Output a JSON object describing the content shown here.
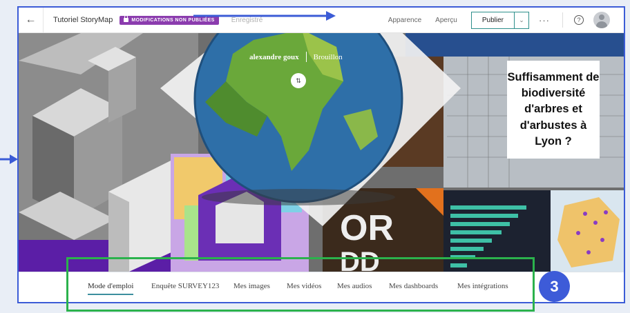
{
  "topbar": {
    "back_glyph": "←",
    "title": "Tutoriel StoryMap",
    "status_badge": "MODIFICATIONS NON PUBLIÉES",
    "saved_status": "Enregistré",
    "appearance": "Apparence",
    "preview": "Aperçu",
    "publish": "Publier",
    "publish_chevron": "⌄",
    "more": "···",
    "help": "?",
    "icons": [
      "back-arrow-icon",
      "lock-icon",
      "chevron-down-icon",
      "more-icon",
      "help-icon",
      "user-avatar-icon"
    ]
  },
  "cover": {
    "author": "alexandre goux",
    "status": "Brouillon",
    "swap_glyph": "⇅",
    "poster_lines": [
      "Suffisamment de",
      "biodiversité",
      "d'arbres et",
      "d'arbustes à",
      "Lyon ?"
    ]
  },
  "navigation": {
    "items": [
      {
        "label": "Mode d'emploi",
        "active": true
      },
      {
        "label": "Enquête SURVEY123",
        "active": false
      },
      {
        "label": "Mes images",
        "active": false
      },
      {
        "label": "Mes vidéos",
        "active": false
      },
      {
        "label": "Mes audios",
        "active": false
      },
      {
        "label": "Mes dashboards",
        "active": false
      },
      {
        "label": "Mes intégrations",
        "active": false
      }
    ]
  },
  "annotation": {
    "marker_number": "3",
    "colors": {
      "frame": "#3b5bd6",
      "highlight": "#2bb24c",
      "marker": "#3d5bd8",
      "badge": "#8b3cae",
      "accent": "#3c8f9e"
    }
  }
}
